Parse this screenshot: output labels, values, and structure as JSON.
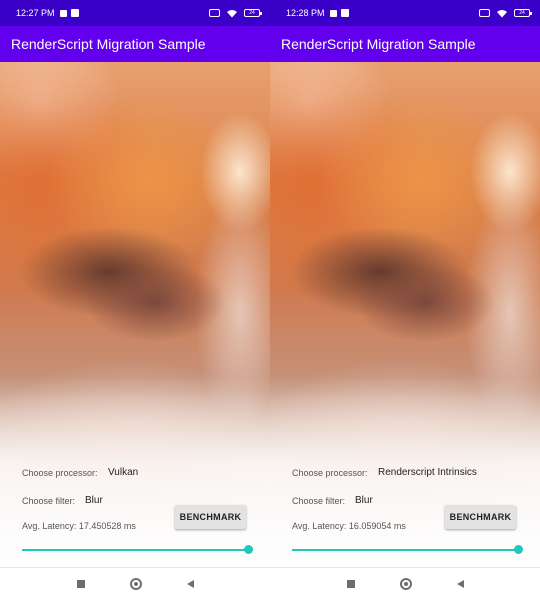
{
  "app_title": "RenderScript Migration Sample",
  "colors": {
    "status_bar": "#3a00c8",
    "app_bar": "#6200ee",
    "accent": "#1fc8b8"
  },
  "labels": {
    "processor": "Choose processor:",
    "filter": "Choose filter:",
    "benchmark": "BENCHMARK"
  },
  "screens": [
    {
      "status_time": "12:27 PM",
      "battery": "24",
      "processor": "Vulkan",
      "filter": "Blur",
      "latency": "Avg. Latency: 17.450528 ms",
      "slider_fraction": 1.0
    },
    {
      "status_time": "12:28 PM",
      "battery": "24",
      "processor": "Renderscript Intrinsics",
      "filter": "Blur",
      "latency": "Avg. Latency: 16.059054 ms",
      "slider_fraction": 1.0
    }
  ],
  "icons": [
    "notification-square-icon",
    "download-icon",
    "x-box-icon",
    "wifi-icon",
    "battery-icon",
    "recents-icon",
    "home-icon",
    "back-icon"
  ]
}
